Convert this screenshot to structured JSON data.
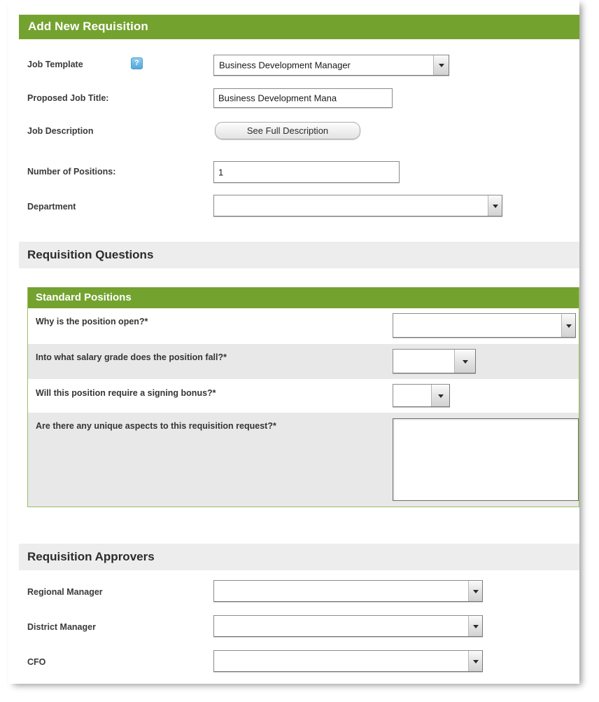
{
  "header": {
    "title": "Add New Requisition",
    "accent_color": "#74a22f"
  },
  "form": {
    "rows": [
      {
        "label": "Job Template",
        "help_icon": "?",
        "control": "select",
        "value": "Business Development Manager"
      },
      {
        "label": "Proposed Job Title:",
        "control": "text",
        "value": "Business Development Mana"
      },
      {
        "label": "Job Description",
        "control": "button",
        "value": "See Full Description"
      },
      {
        "label": "Number of Positions:",
        "control": "text",
        "value": "1"
      },
      {
        "label": "Department",
        "control": "select",
        "value": ""
      }
    ]
  },
  "questions_section": {
    "band_title": "Requisition Questions",
    "panel_title": "Standard Positions",
    "questions": [
      {
        "label": "Why is the position open?*",
        "control": "select",
        "value": ""
      },
      {
        "label": "Into what salary grade does the position fall?*",
        "control": "select",
        "value": ""
      },
      {
        "label": "Will this position require a signing bonus?*",
        "control": "select",
        "value": ""
      },
      {
        "label": "Are there any unique aspects to this requisition request?*",
        "control": "textarea",
        "value": ""
      }
    ]
  },
  "approvers_section": {
    "band_title": "Requisition Approvers",
    "rows": [
      {
        "label": "Regional Manager",
        "control": "select",
        "value": ""
      },
      {
        "label": "District Manager",
        "control": "select",
        "value": ""
      },
      {
        "label": "CFO",
        "control": "select",
        "value": ""
      }
    ]
  }
}
